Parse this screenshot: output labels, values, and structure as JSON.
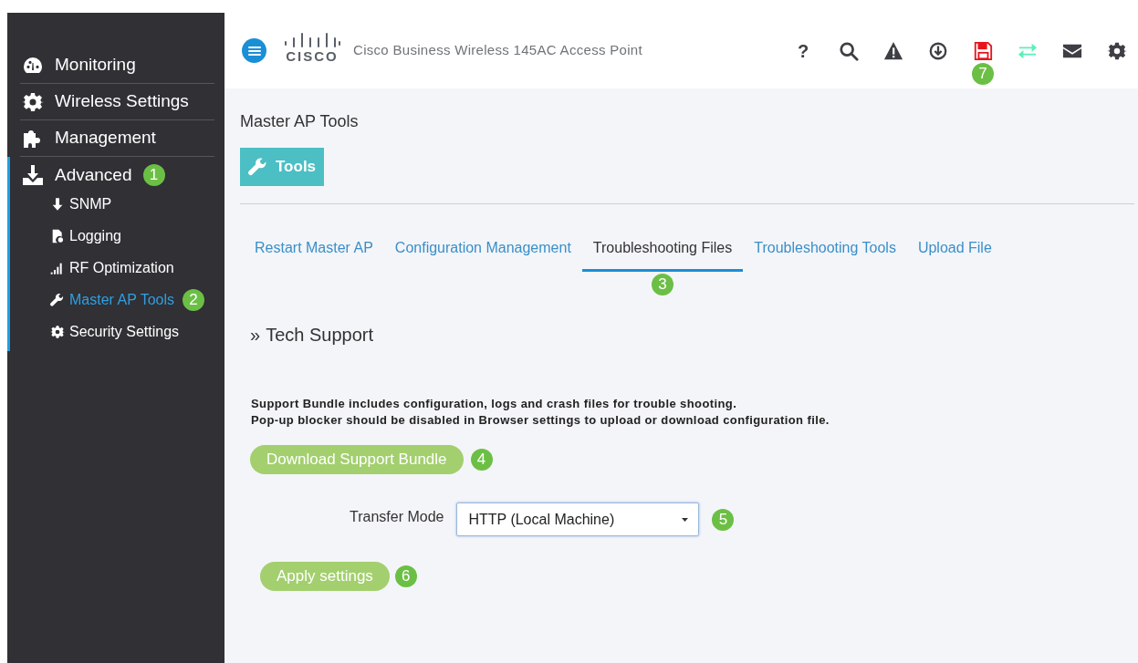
{
  "sidebar": {
    "items": [
      {
        "label": "Monitoring",
        "kind": "dashboard",
        "selected": false
      },
      {
        "label": "Wireless Settings",
        "kind": "gear",
        "selected": false
      },
      {
        "label": "Management",
        "kind": "puzzle",
        "selected": false
      },
      {
        "label": "Advanced",
        "kind": "download",
        "selected": true,
        "callout": "1",
        "children": [
          {
            "label": "SNMP",
            "kind": "arrow",
            "selected": false
          },
          {
            "label": "Logging",
            "kind": "file",
            "selected": false
          },
          {
            "label": "RF Optimization",
            "kind": "signal",
            "selected": false
          },
          {
            "label": "Master AP Tools",
            "kind": "wrench",
            "selected": true,
            "callout": "2"
          },
          {
            "label": "Security Settings",
            "kind": "gear",
            "selected": false
          }
        ]
      }
    ]
  },
  "header": {
    "logo_text": "CISCO",
    "title": "Cisco Business Wireless 145AC Access Point",
    "toolbar": [
      {
        "kind": "help",
        "label": "?"
      },
      {
        "kind": "search"
      },
      {
        "kind": "warning"
      },
      {
        "kind": "download"
      },
      {
        "kind": "save",
        "callout": "7"
      },
      {
        "kind": "sync"
      },
      {
        "kind": "mail"
      },
      {
        "kind": "settings"
      }
    ]
  },
  "page": {
    "title": "Master AP Tools",
    "tool_button": "Tools",
    "tabs": [
      {
        "label": "Restart Master AP",
        "selected": false
      },
      {
        "label": "Configuration Management",
        "selected": false
      },
      {
        "label": "Troubleshooting Files",
        "selected": true,
        "callout": "3"
      },
      {
        "label": "Troubleshooting Tools",
        "selected": false
      },
      {
        "label": "Upload File",
        "selected": false
      }
    ],
    "section_marker": "»",
    "section_title": "Tech Support",
    "notice": [
      "Support Bundle includes configuration, logs and crash files for trouble shooting.",
      "Pop-up blocker should be disabled in Browser settings to upload or download configuration file."
    ],
    "download_button": {
      "label": "Download Support Bundle",
      "callout": "4"
    },
    "transfer_mode": {
      "label": "Transfer Mode",
      "value": "HTTP (Local Machine)",
      "callout": "5"
    },
    "apply_button": {
      "label": "Apply settings",
      "callout": "6"
    }
  }
}
